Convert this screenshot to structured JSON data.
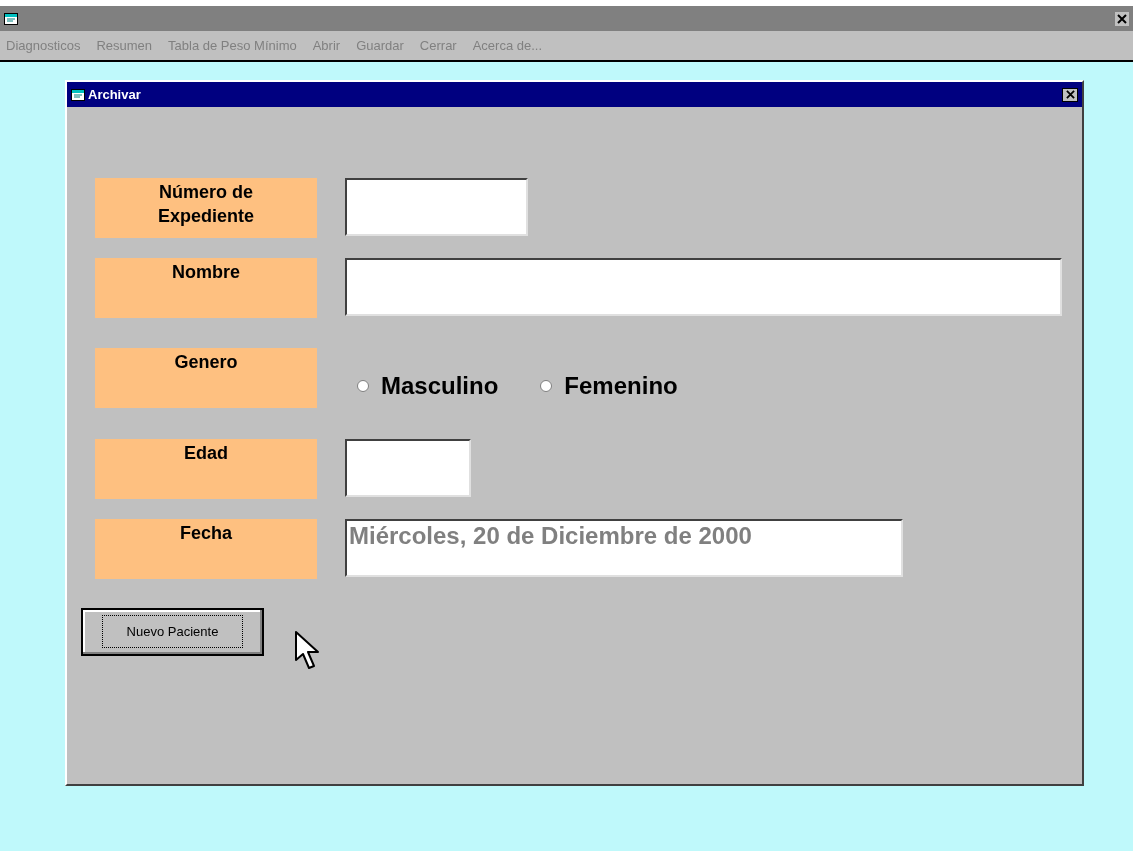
{
  "menu": [
    "Diagnosticos",
    "Resumen",
    "Tabla de Peso Mínimo",
    "Abrir",
    "Guardar",
    "Cerrar",
    "Acerca de..."
  ],
  "dialog": {
    "title": "Archivar",
    "rows": [
      {
        "kind": "field",
        "label": "Número de Expediente"
      },
      {
        "kind": "field",
        "label": "Nombre"
      },
      {
        "kind": "radio",
        "label": "Genero",
        "options": [
          {
            "label": "Masculino",
            "selected": false
          },
          {
            "label": "Femenino",
            "selected": false
          }
        ]
      },
      {
        "kind": "field",
        "label": "Edad"
      },
      {
        "kind": "field",
        "label": "Fecha",
        "value": "Miércoles, 20 de Diciembre de 2000",
        "disabled": true
      }
    ],
    "button": "Nuevo Paciente"
  }
}
